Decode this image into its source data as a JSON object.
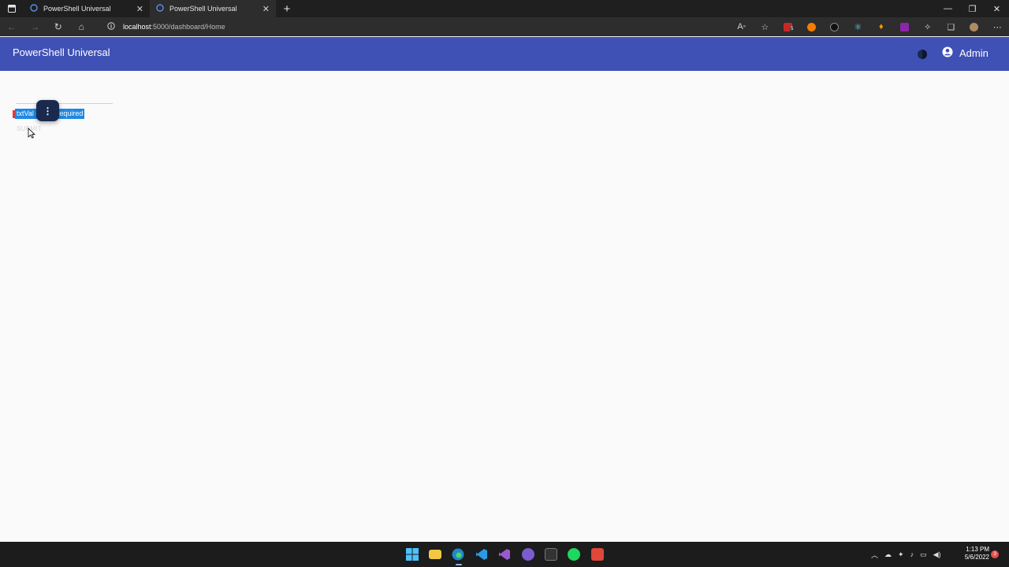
{
  "browser": {
    "tabs": [
      {
        "title": "PowerShell Universal",
        "active": false
      },
      {
        "title": "PowerShell Universal",
        "active": true
      }
    ],
    "new_tab_symbol": "+",
    "address": {
      "host": "localhost",
      "path": ":5000/dashboard/Home"
    },
    "extensions": [
      "read-aloud-icon",
      "favorite-add-icon",
      "extension-red-icon",
      "extension-orange-icon",
      "extension-dark-icon",
      "react-devtools-icon",
      "extension-flame-icon",
      "extension-purple-icon",
      "extensions-icon",
      "collections-icon",
      "profile-avatar-icon",
      "more-menu-icon"
    ],
    "extension_badge": "5"
  },
  "app": {
    "title": "PowerShell Universal",
    "user": "Admin",
    "accent": "#3f51b5"
  },
  "form": {
    "error_text": "txtVal       orm is required",
    "submit_label": "SUBMIT",
    "error_color": "#e53935",
    "selection_color": "#1e88e5"
  },
  "taskbar": {
    "apps": [
      "start-icon",
      "file-explorer-icon",
      "edge-icon",
      "vscode-icon",
      "visual-studio-icon",
      "github-desktop-icon",
      "terminal-icon",
      "spotify-icon",
      "red-app-icon"
    ],
    "clock_time": "1:13 PM",
    "clock_date": "5/6/2022",
    "notification_count": "3"
  }
}
